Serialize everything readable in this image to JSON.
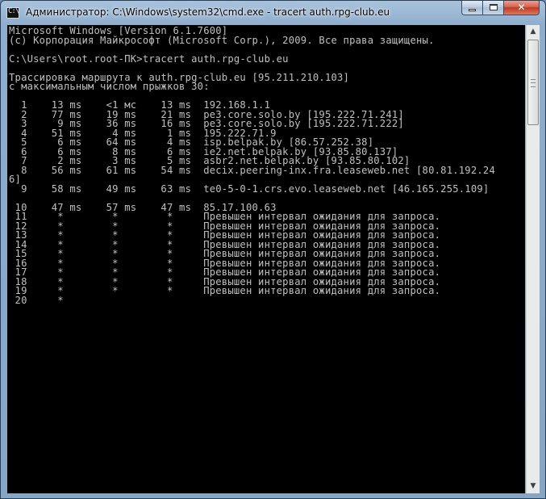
{
  "window": {
    "title": "Администратор: C:\\Windows\\system32\\cmd.exe - tracert  auth.rpg-club.eu",
    "app_icon": "cmd-icon",
    "app_icon_glyph": "C:\\",
    "minimize_icon": "minimize-icon",
    "maximize_icon": "maximize-icon",
    "close_icon": "close-icon",
    "close_glyph": "✕"
  },
  "colors": {
    "console_bg": "#000000",
    "console_fg": "#c0c0c0",
    "close_button": "#c0391f"
  },
  "scrollbar": {
    "up_glyph": "▲",
    "down_glyph": "▼"
  },
  "console_lines": [
    "Microsoft Windows [Version 6.1.7600]",
    "(c) Корпорация Майкрософт (Microsoft Corp.), 2009. Все права защищены.",
    "",
    "C:\\Users\\root.root-ПК>tracert auth.rpg-club.eu",
    "",
    "Трассировка маршрута к auth.rpg-club.eu [95.211.210.103]",
    "с максимальным числом прыжков 30:",
    "",
    "  1    13 ms    <1 мс    13 ms  192.168.1.1",
    "  2    77 ms    19 ms    21 ms  pe3.core.solo.by [195.222.71.241]",
    "  3     9 ms    36 ms    16 ms  pe3.core.solo.by [195.222.71.222]",
    "  4    51 ms     4 ms     1 ms  195.222.71.9",
    "  5     6 ms    64 ms     4 ms  isp.belpak.by [86.57.252.38]",
    "  6     6 ms     8 ms     6 ms  ie2.net.belpak.by [93.85.80.137]",
    "  7     2 ms     3 ms     5 ms  asbr2.net.belpak.by [93.85.80.102]",
    "  8    56 ms    61 ms    54 ms  decix.peering-inx.fra.leaseweb.net [80.81.192.24",
    "6]",
    "  9    58 ms    49 ms    63 ms  te0-5-0-1.crs.evo.leaseweb.net [46.165.255.109]",
    "",
    " 10    47 ms    57 ms    47 ms  85.17.100.63",
    " 11     *        *        *     Превышен интервал ожидания для запроса.",
    " 12     *        *        *     Превышен интервал ожидания для запроса.",
    " 13     *        *        *     Превышен интервал ожидания для запроса.",
    " 14     *        *        *     Превышен интервал ожидания для запроса.",
    " 15     *        *        *     Превышен интервал ожидания для запроса.",
    " 16     *        *        *     Превышен интервал ожидания для запроса.",
    " 17     *        *        *     Превышен интервал ожидания для запроса.",
    " 18     *        *        *     Превышен интервал ожидания для запроса.",
    " 19     *        *        *     Превышен интервал ожидания для запроса.",
    " 20     *"
  ]
}
